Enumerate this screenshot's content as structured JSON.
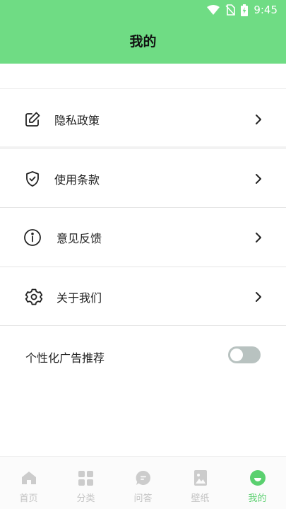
{
  "status": {
    "time": "9:45"
  },
  "header": {
    "title": "我的"
  },
  "menu": [
    {
      "label": "隐私政策",
      "icon": "edit-icon"
    },
    {
      "label": "使用条款",
      "icon": "shield-icon"
    },
    {
      "label": "意见反馈",
      "icon": "info-icon"
    },
    {
      "label": "关于我们",
      "icon": "gear-icon"
    }
  ],
  "ad_toggle": {
    "label": "个性化广告推荐",
    "on": false
  },
  "tabs": [
    {
      "label": "首页",
      "icon": "home-icon",
      "active": false
    },
    {
      "label": "分类",
      "icon": "grid-icon",
      "active": false
    },
    {
      "label": "问答",
      "icon": "chat-icon",
      "active": false
    },
    {
      "label": "壁纸",
      "icon": "image-icon",
      "active": false
    },
    {
      "label": "我的",
      "icon": "profile-icon",
      "active": true
    }
  ],
  "colors": {
    "accent": "#6fdc84",
    "tab_active": "#5ad06f",
    "tab_inactive": "#c4c4c4",
    "toggle_off": "#b8c2c0"
  }
}
